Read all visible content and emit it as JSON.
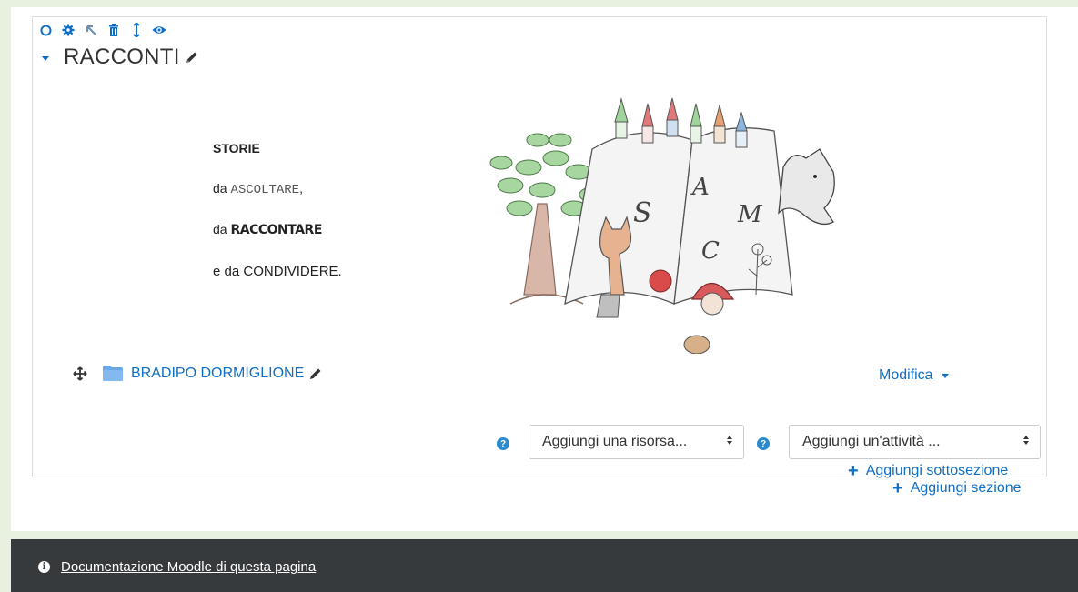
{
  "section": {
    "title": "RACCONTI",
    "toolbar_icons": [
      "circle-icon",
      "gear-icon",
      "arrow-up-left-icon",
      "trash-icon",
      "move-vertical-icon",
      "eye-icon"
    ],
    "story": {
      "line1": "STORIE",
      "line2_prefix": "da ",
      "line2_word": "ASCOLTARE",
      "line2_suffix": ",",
      "line3_prefix": "da ",
      "line3_word": "RACCONTARE",
      "line4": "e da CONDIVIDERE."
    },
    "drawing_letters": [
      "S",
      "A",
      "M",
      "C"
    ]
  },
  "activity": {
    "label": "BRADIPO DORMIGLIONE",
    "edit_menu": "Modifica"
  },
  "add_controls": {
    "resource_select": "Aggiungi una risorsa...",
    "activity_select": "Aggiungi un'attività ...",
    "add_subsection": "Aggiungi sottosezione",
    "add_section": "Aggiungi sezione"
  },
  "footer": {
    "doc_link": "Documentazione Moodle di questa pagina"
  },
  "colors": {
    "accent": "#0f6fc5",
    "footer_bg": "#373a3c",
    "page_bg": "#e8f1df"
  }
}
